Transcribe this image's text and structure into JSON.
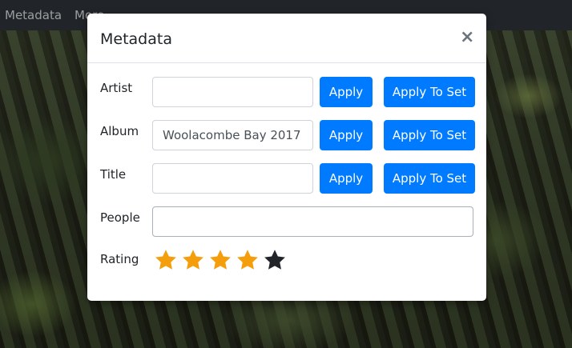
{
  "navbar": {
    "items": [
      {
        "label": "Metadata"
      },
      {
        "label": "More"
      }
    ]
  },
  "modal": {
    "title": "Metadata",
    "close_glyph": "×",
    "fields": [
      {
        "label": "Artist",
        "value": "",
        "placeholder": "",
        "apply_label": "Apply",
        "apply_set_label": "Apply To Set"
      },
      {
        "label": "Album",
        "value": "Woolacombe Bay 2017",
        "placeholder": "",
        "apply_label": "Apply",
        "apply_set_label": "Apply To Set"
      },
      {
        "label": "Title",
        "value": "",
        "placeholder": "",
        "apply_label": "Apply",
        "apply_set_label": "Apply To Set"
      }
    ],
    "people": {
      "label": "People",
      "value": ""
    },
    "rating": {
      "label": "Rating",
      "value": 4,
      "max": 5
    }
  },
  "colors": {
    "accent": "#007bff",
    "star_filled": "#f59e0b",
    "star_empty": "#212529",
    "navbar": "#212529"
  }
}
